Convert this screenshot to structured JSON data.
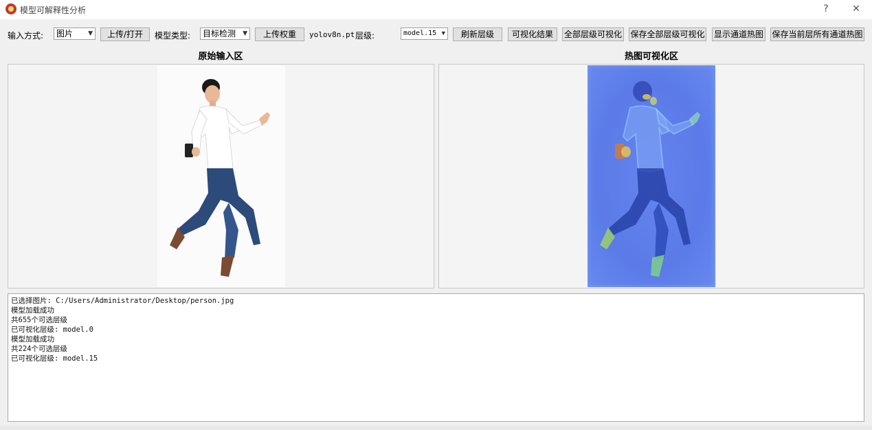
{
  "window": {
    "title": "模型可解释性分析",
    "help_glyph": "?",
    "close_glyph": "✕"
  },
  "toolbar": {
    "input_mode_label": "输入方式:",
    "input_mode_value": "图片",
    "upload_open_label": "上传/打开",
    "model_type_label": "模型类型:",
    "model_type_value": "目标检测",
    "upload_weights_label": "上传权重",
    "weights_file": "yolov8n.pt",
    "layer_label": "层级:",
    "layer_value": "model.15",
    "refresh_layers_label": "刷新层级",
    "visualize_result_label": "可视化结果",
    "visualize_all_layers_label": "全部层级可视化",
    "save_all_layers_label": "保存全部层级可视化",
    "show_channel_heatmap_label": "显示通道热图",
    "save_current_layer_channels_label": "保存当前层所有通道热图"
  },
  "panels": {
    "original_title": "原始输入区",
    "heatmap_title": "热图可视化区"
  },
  "log": {
    "lines": [
      "已选择图片: C:/Users/Administrator/Desktop/person.jpg",
      "模型加载成功",
      "共655个可选层级",
      "已可视化层级: model.0",
      "模型加载成功",
      "共224个可选层级",
      "已可视化层级: model.15"
    ]
  },
  "colors": {
    "heatmap_base": "#5b7be8",
    "shirt": "#ffffff",
    "jeans": "#2c4a7a",
    "skin": "#e9b896"
  },
  "icons": {
    "app": "app-logo-icon",
    "dropdown": "chevron-down-icon"
  }
}
